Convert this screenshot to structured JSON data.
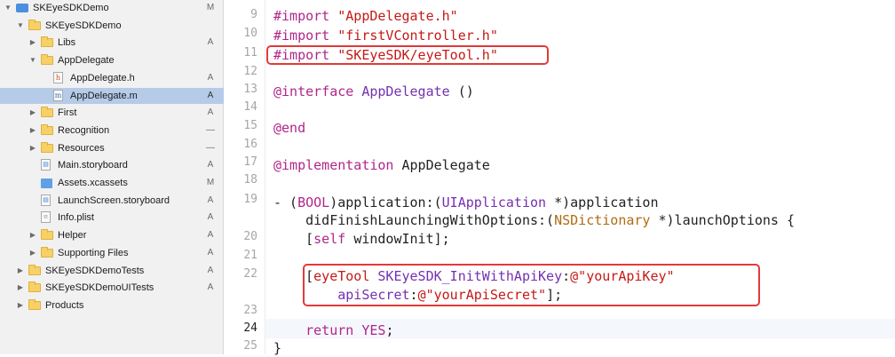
{
  "navigator": {
    "items": [
      {
        "label": "SKEyeSDKDemo",
        "badge": "M",
        "icon": "project-icon",
        "disclosure": "expanded",
        "indent": 0
      },
      {
        "label": "SKEyeSDKDemo",
        "badge": "",
        "icon": "folder-icon",
        "disclosure": "expanded",
        "indent": 1
      },
      {
        "label": "Libs",
        "badge": "A",
        "icon": "folder-icon",
        "disclosure": "collapsed",
        "indent": 2
      },
      {
        "label": "AppDelegate",
        "badge": "",
        "icon": "folder-icon",
        "disclosure": "expanded",
        "indent": 2
      },
      {
        "label": "AppDelegate.h",
        "badge": "A",
        "icon": "header-file-icon",
        "disclosure": "none",
        "indent": 3
      },
      {
        "label": "AppDelegate.m",
        "badge": "A",
        "icon": "source-file-icon",
        "disclosure": "none",
        "indent": 3,
        "selected": true
      },
      {
        "label": "First",
        "badge": "A",
        "icon": "folder-icon",
        "disclosure": "collapsed",
        "indent": 2
      },
      {
        "label": "Recognition",
        "badge": "—",
        "icon": "folder-icon",
        "disclosure": "collapsed",
        "indent": 2
      },
      {
        "label": "Resources",
        "badge": "—",
        "icon": "folder-icon",
        "disclosure": "collapsed",
        "indent": 2
      },
      {
        "label": "Main.storyboard",
        "badge": "A",
        "icon": "storyboard-file-icon",
        "disclosure": "none",
        "indent": 2
      },
      {
        "label": "Assets.xcassets",
        "badge": "M",
        "icon": "asset-catalog-icon",
        "disclosure": "none",
        "indent": 2
      },
      {
        "label": "LaunchScreen.storyboard",
        "badge": "A",
        "icon": "storyboard-file-icon",
        "disclosure": "none",
        "indent": 2
      },
      {
        "label": "Info.plist",
        "badge": "A",
        "icon": "plist-file-icon",
        "disclosure": "none",
        "indent": 2
      },
      {
        "label": "Helper",
        "badge": "A",
        "icon": "folder-icon",
        "disclosure": "collapsed",
        "indent": 2
      },
      {
        "label": "Supporting Files",
        "badge": "A",
        "icon": "folder-icon",
        "disclosure": "collapsed",
        "indent": 2
      },
      {
        "label": "SKEyeSDKDemoTests",
        "badge": "A",
        "icon": "folder-icon",
        "disclosure": "collapsed",
        "indent": 1
      },
      {
        "label": "SKEyeSDKDemoUITests",
        "badge": "A",
        "icon": "folder-icon",
        "disclosure": "collapsed",
        "indent": 1
      },
      {
        "label": "Products",
        "badge": "",
        "icon": "folder-icon",
        "disclosure": "collapsed",
        "indent": 1
      }
    ]
  },
  "editor": {
    "current_line": "24",
    "highlight_color": "#e23a3a",
    "lines": [
      {
        "num": "9",
        "tokens": [
          [
            "kw",
            "#import "
          ],
          [
            "str",
            "\"AppDelegate.h\""
          ]
        ]
      },
      {
        "num": "10",
        "tokens": [
          [
            "kw",
            "#import "
          ],
          [
            "str",
            "\"firstVController.h\""
          ]
        ]
      },
      {
        "num": "11",
        "tokens": [
          [
            "kw",
            "#import "
          ],
          [
            "str",
            "\"SKEyeSDK/eyeTool.h\""
          ]
        ]
      },
      {
        "num": "12",
        "tokens": []
      },
      {
        "num": "13",
        "tokens": [
          [
            "kw",
            "@interface "
          ],
          [
            "cls",
            "AppDelegate "
          ],
          [
            "pl",
            "()"
          ]
        ]
      },
      {
        "num": "14",
        "tokens": []
      },
      {
        "num": "15",
        "tokens": [
          [
            "kw",
            "@end"
          ]
        ]
      },
      {
        "num": "16",
        "tokens": []
      },
      {
        "num": "17",
        "tokens": [
          [
            "kw",
            "@implementation "
          ],
          [
            "pl",
            "AppDelegate"
          ]
        ]
      },
      {
        "num": "18",
        "tokens": []
      },
      {
        "num": "19",
        "tokens": [
          [
            "pl",
            "- ("
          ],
          [
            "kw",
            "BOOL"
          ],
          [
            "pl",
            ")application:("
          ],
          [
            "cls",
            "UIApplication "
          ],
          [
            "pl",
            "*)application"
          ]
        ]
      },
      {
        "num": "",
        "tokens": [
          [
            "pl",
            "    didFinishLaunchingWithOptions:("
          ],
          [
            "ty",
            "NSDictionary "
          ],
          [
            "pl",
            "*)launchOptions {"
          ]
        ]
      },
      {
        "num": "20",
        "tokens": [
          [
            "pl",
            "    ["
          ],
          [
            "kw",
            "self "
          ],
          [
            "pl",
            "windowInit];"
          ]
        ]
      },
      {
        "num": "21",
        "tokens": []
      },
      {
        "num": "22",
        "tokens": [
          [
            "pl",
            "    ["
          ],
          [
            "str",
            "eyeTool "
          ],
          [
            "cls",
            "SKEyeSDK_InitWithApiKey"
          ],
          [
            "pl",
            ":"
          ],
          [
            "str",
            "@\"yourApiKey\""
          ]
        ]
      },
      {
        "num": "",
        "tokens": [
          [
            "pl",
            "        "
          ],
          [
            "cls",
            "apiSecret"
          ],
          [
            "pl",
            ":"
          ],
          [
            "str",
            "@\"yourApiSecret\""
          ],
          [
            "pl",
            "];"
          ]
        ]
      },
      {
        "num": "23",
        "tokens": []
      },
      {
        "num": "24",
        "tokens": [
          [
            "pl",
            "    "
          ],
          [
            "kw",
            "return YES"
          ],
          [
            "pl",
            ";"
          ]
        ]
      },
      {
        "num": "25",
        "tokens": [
          [
            "pl",
            "}"
          ]
        ]
      }
    ]
  }
}
